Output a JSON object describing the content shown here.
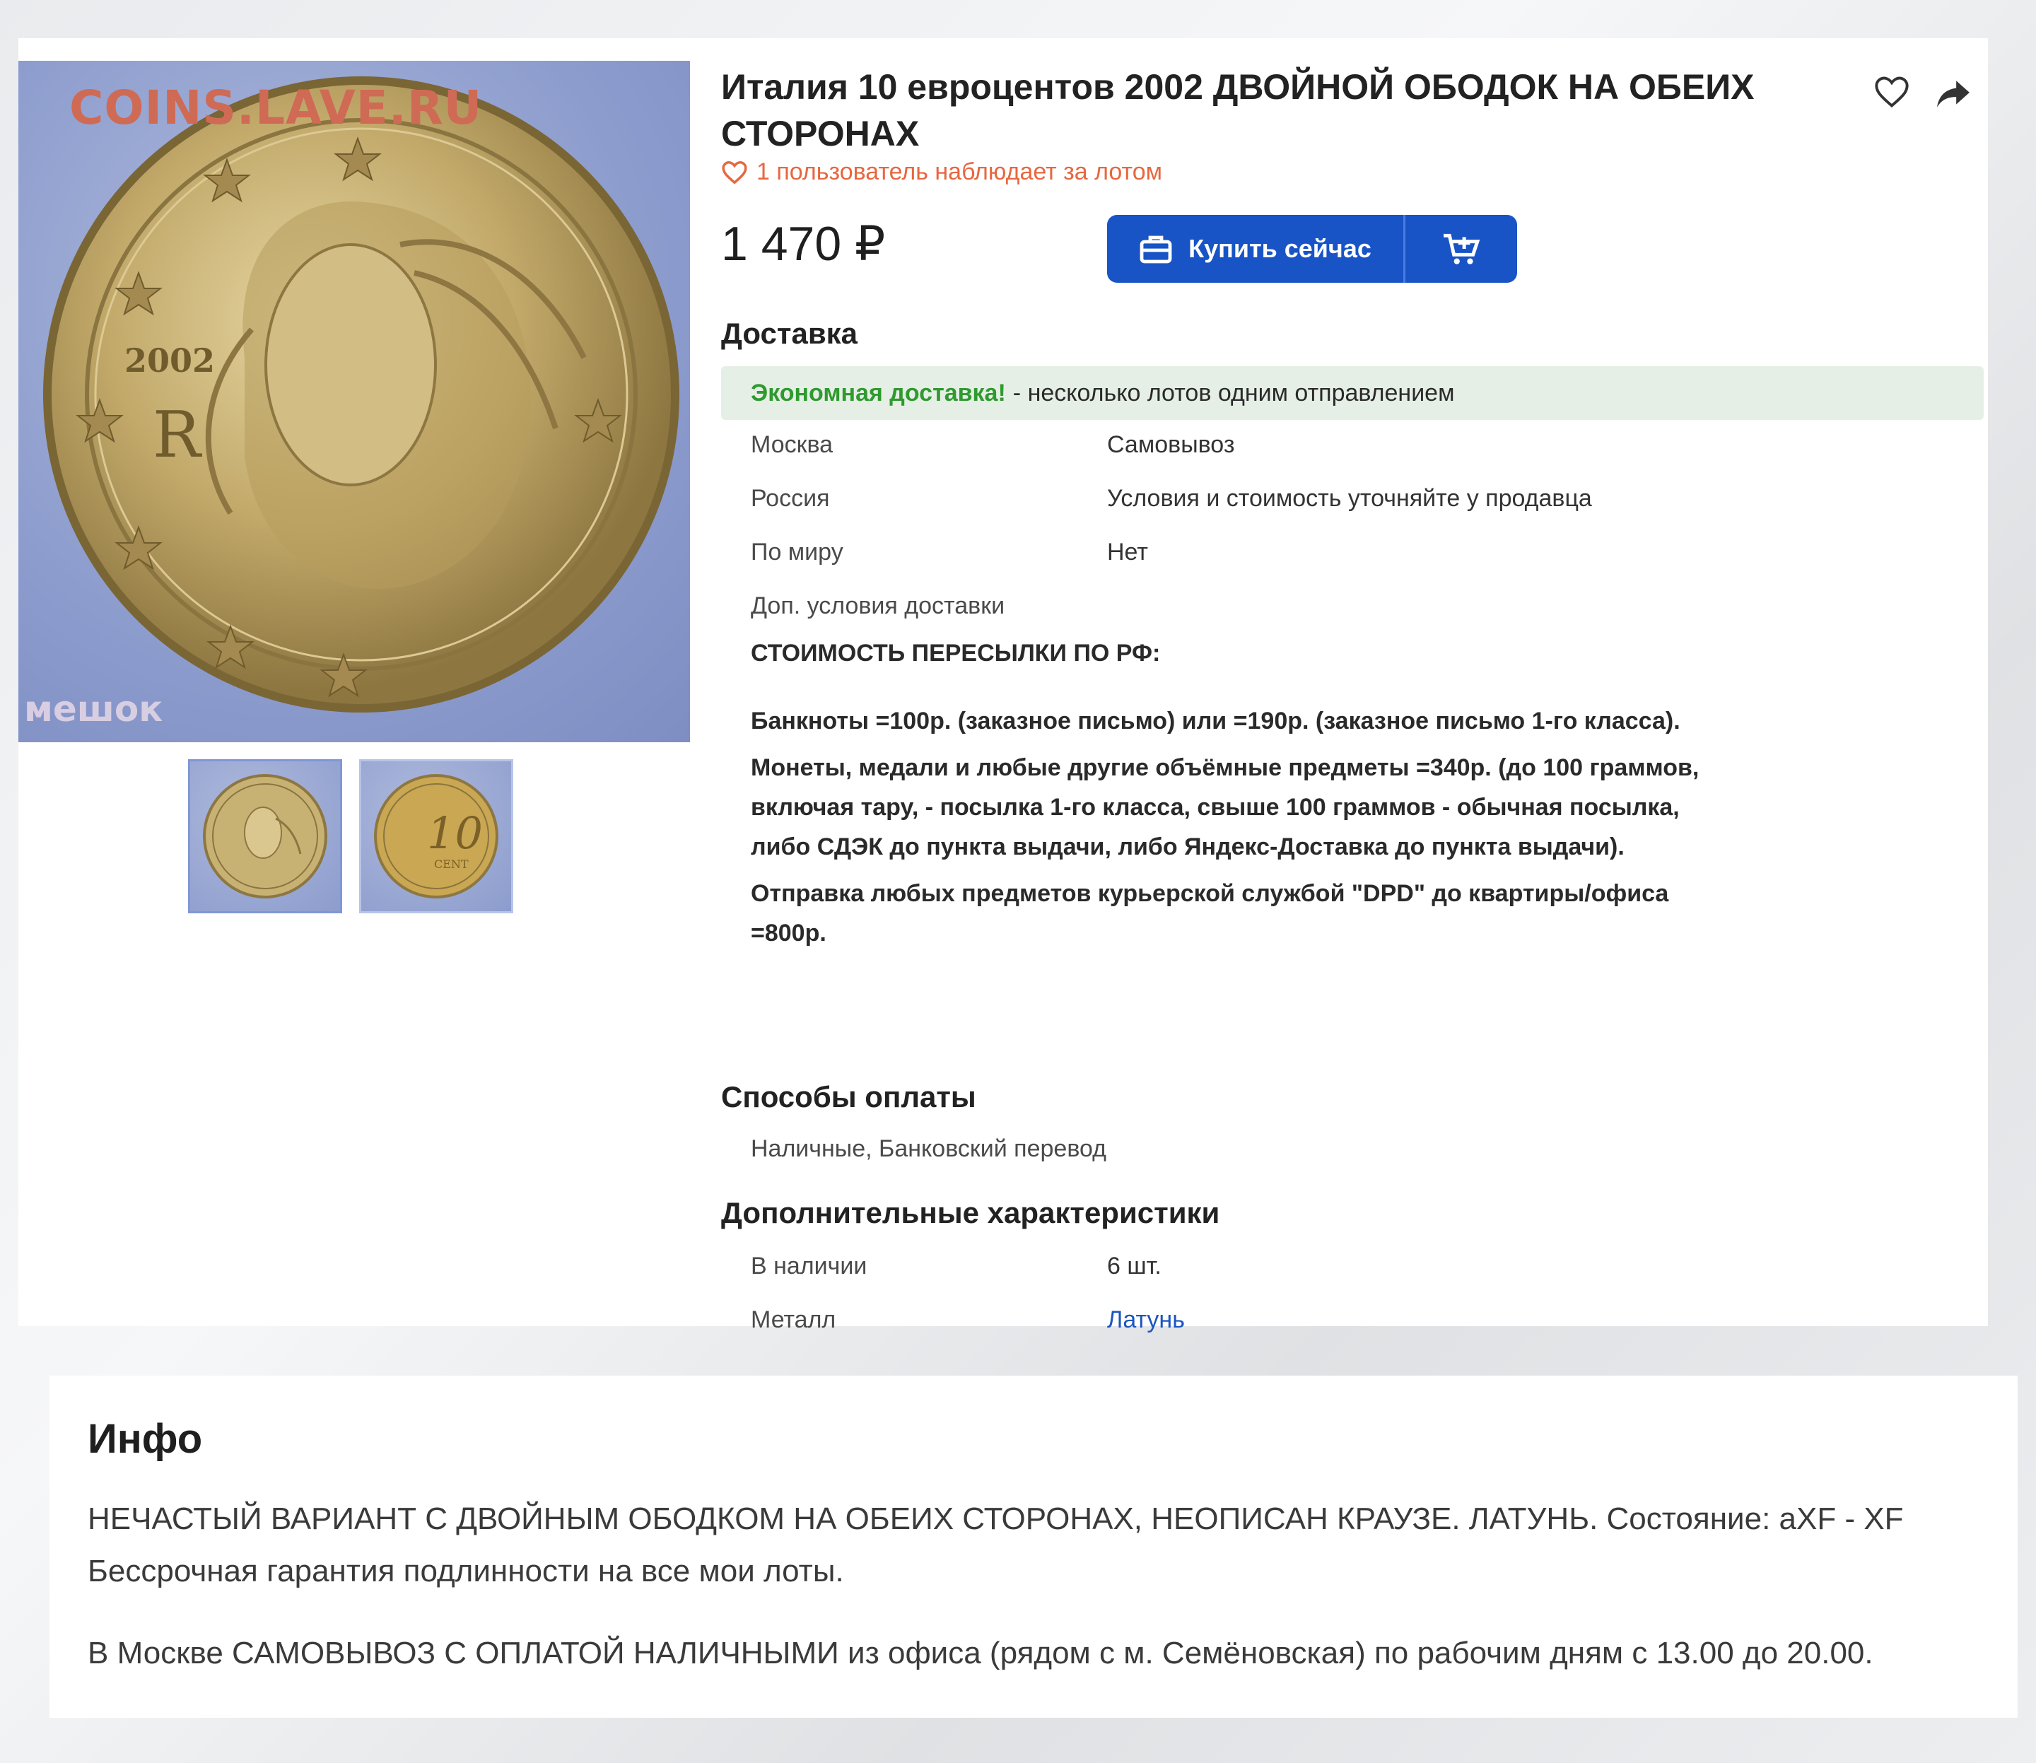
{
  "watermark": "COINS.LAVE.RU",
  "photo_watermark": "мешок",
  "lot": {
    "title": "Италия 10 евроцентов 2002 ДВОЙНОЙ ОБОДОК НА ОБЕИХ СТОРОНАХ",
    "watchers": "1 пользователь наблюдает за лотом",
    "price": "1 470 ₽",
    "buy_label": "Купить сейчас",
    "coin_year": "2002",
    "coin_value": "10",
    "coin_unit": "CENT"
  },
  "delivery": {
    "heading": "Доставка",
    "eco_accent": "Экономная доставка!",
    "eco_text": "- несколько лотов одним отправлением",
    "rows": [
      {
        "label": "Москва",
        "value": "Самовывоз"
      },
      {
        "label": "Россия",
        "value": "Условия и стоимость уточняйте у продавца"
      },
      {
        "label": "По миру",
        "value": "Нет"
      },
      {
        "label": "Доп. условия доставки",
        "value": ""
      }
    ],
    "shipping_heading": "СТОИМОСТЬ ПЕРЕСЫЛКИ ПО РФ:",
    "shipping_lines": [
      "Банкноты =100р. (заказное письмо) или =190р. (заказное письмо 1-го класса).",
      "Монеты, медали и любые другие объёмные предметы =340р. (до 100 граммов, включая тару, - посылка 1-го класса, свыше 100 граммов - обычная посылка, либо СДЭК до пункта выдачи, либо Яндекс-Доставка до пункта выдачи).",
      "Отправка любых предметов курьерской службой \"DPD\" до квартиры/офиса =800р."
    ]
  },
  "payment": {
    "heading": "Способы оплаты",
    "methods": "Наличные, Банковский перевод"
  },
  "extra": {
    "heading": "Дополнительные характеристики",
    "stock_label": "В наличии",
    "stock_value": "6 шт.",
    "metal_label": "Металл",
    "metal_value": "Латунь"
  },
  "info": {
    "heading": "Инфо",
    "line1": "НЕЧАСТЫЙ ВАРИАНТ С ДВОЙНЫМ ОБОДКОМ НА ОБЕИХ СТОРОНАХ, НЕОПИСАН КРАУЗЕ. ЛАТУНЬ. Состояние: aXF - XF",
    "line2": "Бессрочная гарантия подлинности на все мои лоты.",
    "line3": "В Москве САМОВЫВОЗ С ОПЛАТОЙ НАЛИЧНЫМИ из офиса (рядом с м. Семёновская) по рабочим дням с 13.00 до 20.00."
  },
  "colors": {
    "accent_blue": "#1854c6",
    "watch_orange": "#e7673f",
    "eco_green": "#2f9a2f",
    "eco_bg": "#e6efe5",
    "link_blue": "#1c55c1"
  },
  "icons": [
    "heart-icon",
    "share-icon",
    "briefcase-icon",
    "cart-plus-icon"
  ]
}
